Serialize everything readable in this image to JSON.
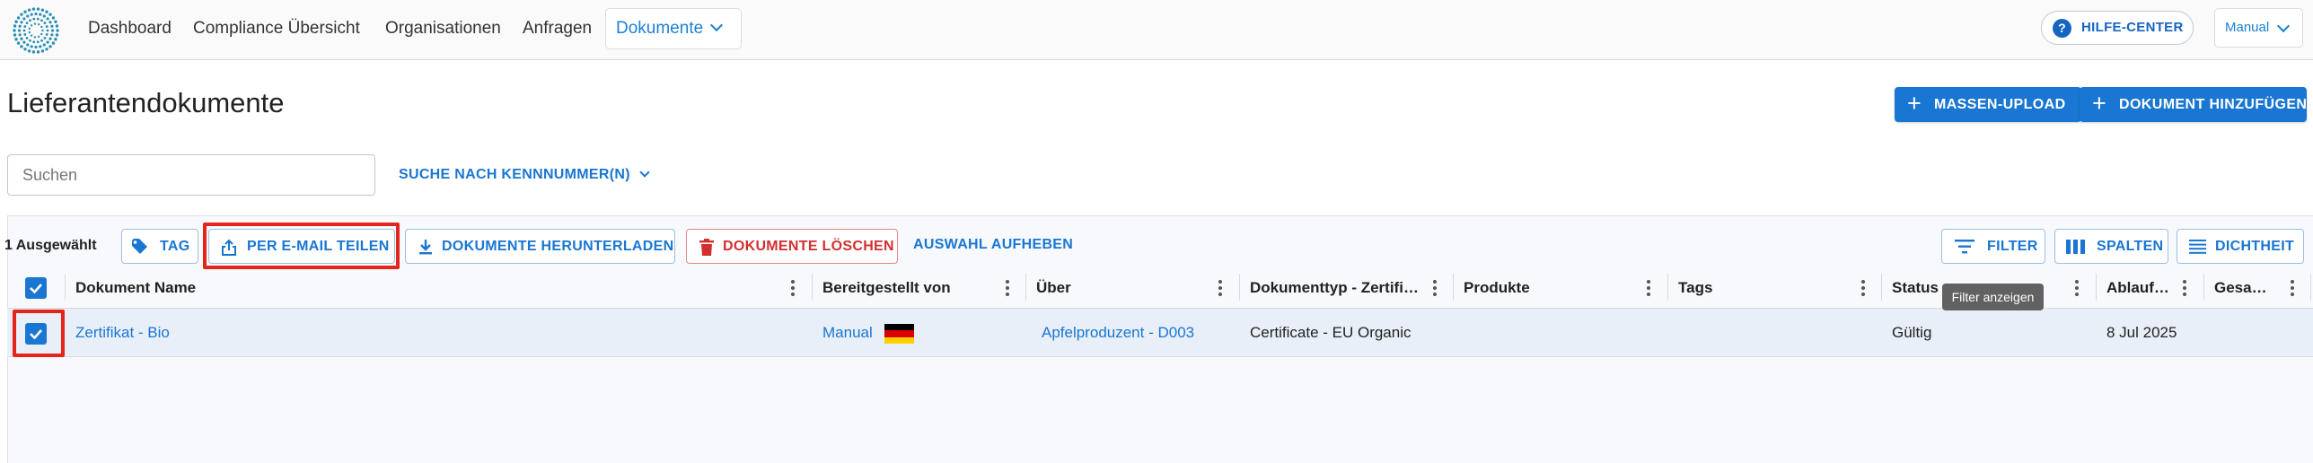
{
  "nav": {
    "items": [
      "Dashboard",
      "Compliance Übersicht",
      "Organisationen",
      "Anfragen"
    ],
    "active": "Dokumente",
    "help": "HILFE-CENTER",
    "user": "Manual"
  },
  "page": {
    "title": "Lieferantendokumente",
    "bulk_upload": "MASSEN-UPLOAD",
    "add_document": "DOKUMENT HINZUFÜGEN"
  },
  "search": {
    "placeholder": "Suchen",
    "mode": "SUCHE NACH KENNNUMMER(N)"
  },
  "toolbar": {
    "selected": "1 Ausgewählt",
    "tag": "TAG",
    "share_email": "PER E-MAIL TEILEN",
    "download": "DOKUMENTE HERUNTERLADEN",
    "delete": "DOKUMENTE LÖSCHEN",
    "clear_selection": "AUSWAHL AUFHEBEN",
    "filter": "FILTER",
    "columns": "SPALTEN",
    "density": "DICHTHEIT",
    "filter_tooltip": "Filter anzeigen"
  },
  "table": {
    "columns": [
      "Dokument Name",
      "Bereitgestellt von",
      "Über",
      "Dokumenttyp - Zertifi…",
      "Produkte",
      "Tags",
      "Status",
      "Ablauf…",
      "Gesa…"
    ],
    "rows": [
      {
        "name": "Zertifikat - Bio",
        "provided_by": "Manual",
        "about": "Apfelproduzent - D003",
        "doc_type": "Certificate - EU Organic",
        "products": "",
        "tags": "",
        "status": "Gültig",
        "expiry": "8 Jul 2025",
        "total": ""
      }
    ]
  },
  "colors": {
    "primary": "#1976d2",
    "danger": "#d32f2f",
    "highlight": "#e5251c",
    "row_selected": "#e8eff8"
  },
  "icons": [
    "logo-icon",
    "chevron-down-icon",
    "help-icon",
    "plus-icon",
    "tag-icon",
    "share-icon",
    "download-icon",
    "trash-icon",
    "filter-icon",
    "columns-icon",
    "density-icon",
    "checkbox-checked-icon",
    "kebab-icon",
    "flag-de-icon"
  ]
}
